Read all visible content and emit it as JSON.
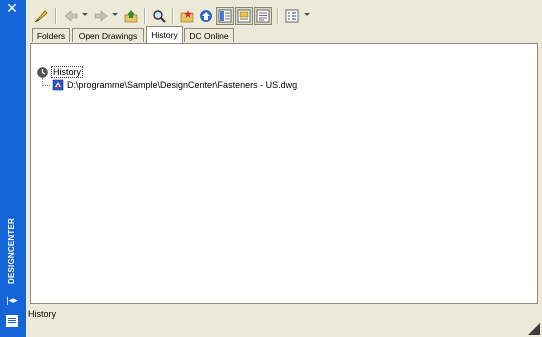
{
  "palette": {
    "panel_title_bar": "#1464d8",
    "panel_bg": "#ece9d8",
    "content_bg": "#ffffff"
  },
  "panel": {
    "vertical_title": "DESIGNCENTER",
    "close_glyph": "✕",
    "autohide_glyph": "|◂▸"
  },
  "toolbar": {
    "icons": [
      "load-icon",
      "back-icon",
      "forward-icon",
      "up-icon",
      "search-icon",
      "favorites-icon",
      "home-icon",
      "tree-toggle-icon",
      "preview-icon",
      "description-icon",
      "views-icon"
    ]
  },
  "tabs": [
    {
      "label": "Folders"
    },
    {
      "label": "Open Drawings"
    },
    {
      "label": "History"
    },
    {
      "label": "DC Online"
    }
  ],
  "tree": {
    "root_label": "History",
    "child_label": "D:\\programme\\Sample\\DesignCenter\\Fasteners - US.dwg"
  },
  "status_text": "History"
}
